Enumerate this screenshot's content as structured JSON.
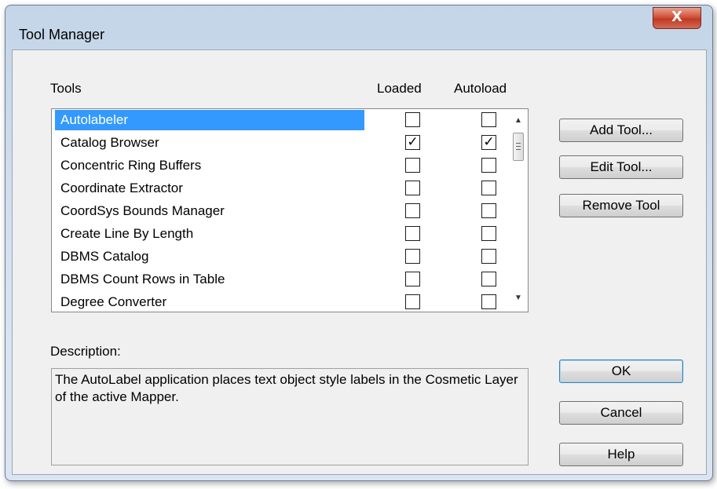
{
  "window": {
    "title": "Tool Manager",
    "close_label": "X"
  },
  "headers": {
    "tools": "Tools",
    "loaded": "Loaded",
    "autoload": "Autoload"
  },
  "tools": [
    {
      "name": "Autolabeler",
      "loaded": false,
      "autoload": false,
      "selected": true
    },
    {
      "name": "Catalog Browser",
      "loaded": true,
      "autoload": true,
      "selected": false
    },
    {
      "name": "Concentric Ring Buffers",
      "loaded": false,
      "autoload": false,
      "selected": false
    },
    {
      "name": "Coordinate Extractor",
      "loaded": false,
      "autoload": false,
      "selected": false
    },
    {
      "name": "CoordSys Bounds Manager",
      "loaded": false,
      "autoload": false,
      "selected": false
    },
    {
      "name": "Create Line By Length",
      "loaded": false,
      "autoload": false,
      "selected": false
    },
    {
      "name": "DBMS Catalog",
      "loaded": false,
      "autoload": false,
      "selected": false
    },
    {
      "name": "DBMS Count Rows in Table",
      "loaded": false,
      "autoload": false,
      "selected": false
    },
    {
      "name": "Degree Converter",
      "loaded": false,
      "autoload": false,
      "selected": false
    }
  ],
  "buttons": {
    "add_tool": "Add Tool...",
    "edit_tool": "Edit Tool...",
    "remove_tool": "Remove Tool",
    "ok": "OK",
    "cancel": "Cancel",
    "help": "Help"
  },
  "description": {
    "label": "Description:",
    "text": "The AutoLabel application places text object style labels in the Cosmetic Layer of the active Mapper."
  },
  "icons": {
    "checkmark": "check-icon",
    "scroll_up": "scroll-up-icon",
    "scroll_down": "scroll-down-icon"
  },
  "colors": {
    "selection": "#3399ff",
    "close_button": "#c13a22",
    "window_frame": "#c4d5e8"
  }
}
